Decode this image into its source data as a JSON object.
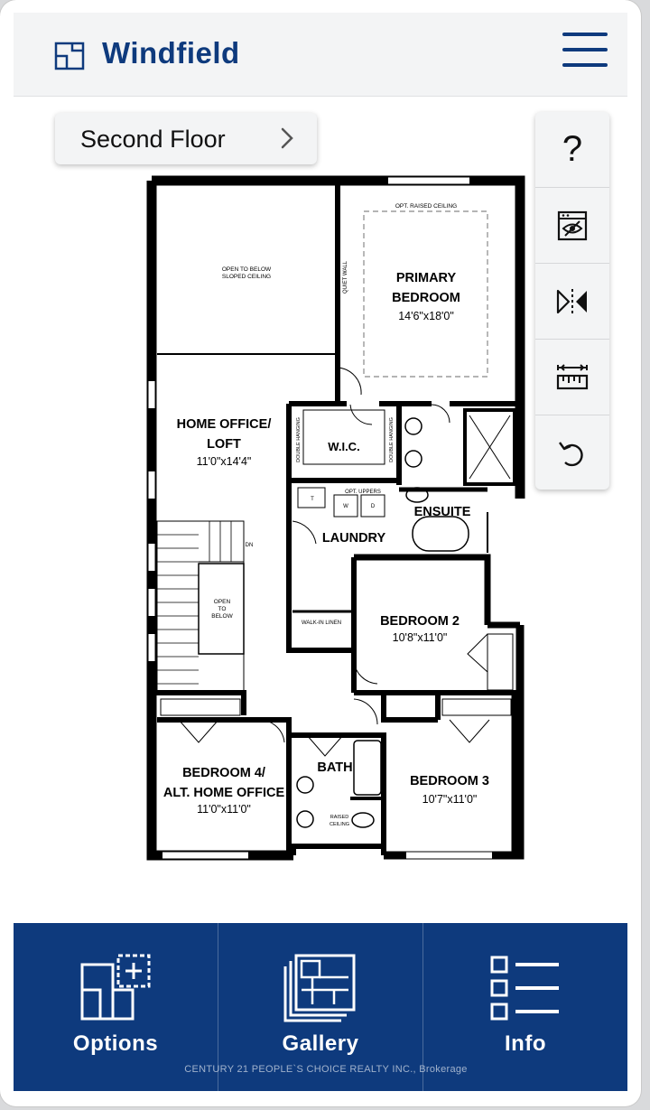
{
  "app": {
    "brand": "Windfield",
    "accent_color": "#0e3a7d",
    "header_bg": "#f3f4f5"
  },
  "floor_selector": {
    "current": "Second Floor",
    "icon": "chevron-right-icon"
  },
  "toolbar": {
    "items": [
      {
        "name": "help",
        "label": "?",
        "icon": "question-mark-icon"
      },
      {
        "name": "hide-furniture",
        "icon": "eye-off-icon"
      },
      {
        "name": "mirror",
        "icon": "mirror-flip-icon"
      },
      {
        "name": "measure",
        "icon": "ruler-icon"
      },
      {
        "name": "reset",
        "icon": "undo-icon"
      }
    ]
  },
  "floorplan": {
    "rooms": {
      "primary_bedroom": {
        "name_line1": "PRIMARY",
        "name_line2": "BEDROOM",
        "size": "14'6\"x18'0\""
      },
      "home_office": {
        "name_line1": "HOME OFFICE/",
        "name_line2": "LOFT",
        "size": "11'0\"x14'4\""
      },
      "wic": {
        "name": "W.I.C."
      },
      "ensuite": {
        "name": "ENSUITE"
      },
      "laundry": {
        "name": "LAUNDRY"
      },
      "bedroom2": {
        "name": "BEDROOM 2",
        "size": "10'8\"x11'0\""
      },
      "bedroom4": {
        "name_line1": "BEDROOM 4/",
        "name_line2": "ALT. HOME OFFICE",
        "size": "11'0\"x11'0\""
      },
      "bath": {
        "name": "BATH"
      },
      "bedroom3": {
        "name": "BEDROOM 3",
        "size": "10'7\"x11'0\""
      }
    },
    "notes": {
      "open_below_line1": "OPEN TO BELOW",
      "open_below_line2": "SLOPED CEILING",
      "raised_ceiling_opt": "OPT. RAISED CEILING",
      "quiet_wall": "QUIET WALL",
      "double_hanging": "DOUBLE HANGING",
      "opt_uppers": "OPT. UPPERS",
      "walk_in_linen": "WALK-IN LINEN",
      "dn": "DN",
      "stair_open_1": "OPEN",
      "stair_open_2": "TO",
      "stair_open_3": "BELOW",
      "raised_1": "RAISED",
      "raised_2": "CEILING",
      "t": "T",
      "w": "W",
      "d": "D"
    }
  },
  "bottom_nav": {
    "bg_color": "#0e3a7d",
    "items": [
      {
        "label": "Options",
        "icon": "floorplan-add-icon"
      },
      {
        "label": "Gallery",
        "icon": "gallery-icon"
      },
      {
        "label": "Info",
        "icon": "list-icon"
      }
    ]
  },
  "footer": {
    "credit": "CENTURY 21 PEOPLE`S CHOICE REALTY INC., Brokerage"
  }
}
